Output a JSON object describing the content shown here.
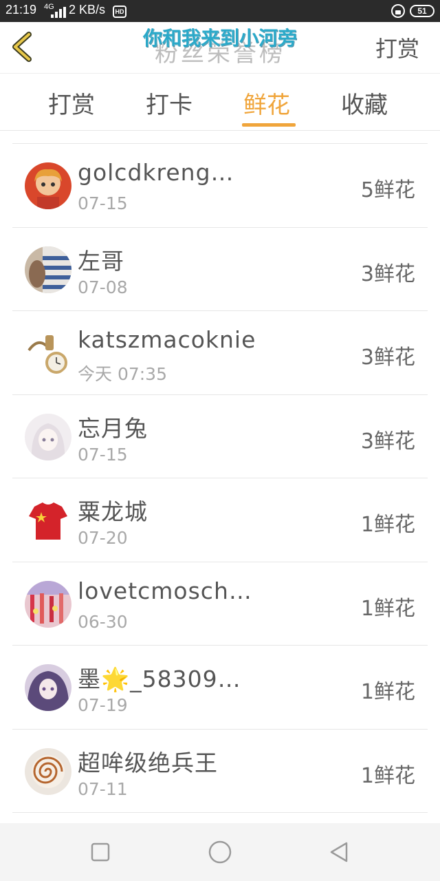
{
  "status_bar": {
    "time": "21:19",
    "network": "4G",
    "speed": "2 KB/s",
    "hd_label": "HD",
    "battery": "51"
  },
  "header": {
    "title": "粉丝荣誉榜",
    "overlay_caption": "你和我来到小河旁",
    "reward_link": "打赏"
  },
  "tabs": [
    {
      "label": "打赏",
      "active": false
    },
    {
      "label": "打卡",
      "active": false
    },
    {
      "label": "鲜花",
      "active": true
    },
    {
      "label": "收藏",
      "active": false
    }
  ],
  "accent_color": "#f0a53b",
  "fans": [
    {
      "name": "golcdkreng…",
      "date": "07-15",
      "amount": "5鲜花",
      "avatar": "cartoon-girl-avatar"
    },
    {
      "name": "左哥",
      "date": "07-08",
      "amount": "3鲜花",
      "avatar": "striped-shirt-avatar"
    },
    {
      "name": "katszmacoknie",
      "date": "今天 07:35",
      "amount": "3鲜花",
      "avatar": "pocket-watch-avatar"
    },
    {
      "name": "忘月兔",
      "date": "07-15",
      "amount": "3鲜花",
      "avatar": "anime-girl-avatar"
    },
    {
      "name": "粟龙城",
      "date": "07-20",
      "amount": "1鲜花",
      "avatar": "red-star-shirt-avatar"
    },
    {
      "name": "lovetcmosch…",
      "date": "06-30",
      "amount": "1鲜花",
      "avatar": "festival-avatar"
    },
    {
      "name": "墨🌟_58309…",
      "date": "07-19",
      "amount": "1鲜花",
      "avatar": "purple-hair-avatar"
    },
    {
      "name": "超哞级绝兵王",
      "date": "07-11",
      "amount": "1鲜花",
      "avatar": "nautilus-shell-avatar"
    }
  ]
}
